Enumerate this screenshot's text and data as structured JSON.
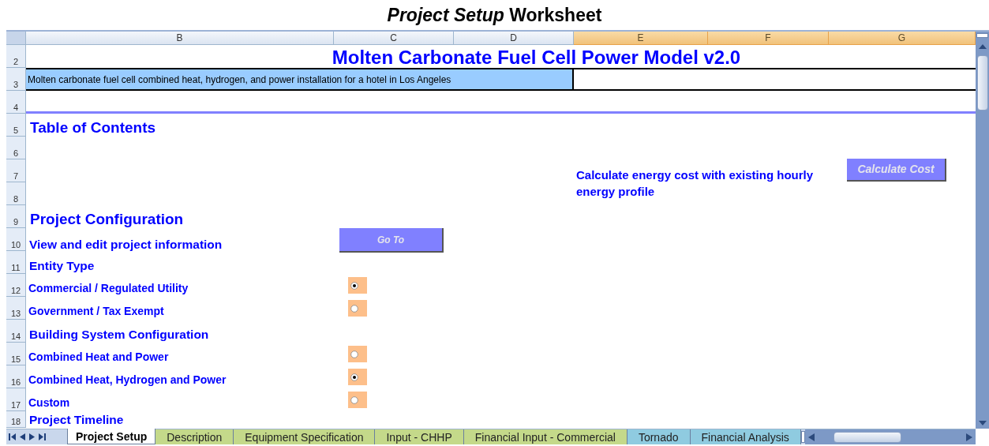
{
  "title": "*Project Setup* Worksheet",
  "columns": [
    {
      "label": "B",
      "selected": false
    },
    {
      "label": "C",
      "selected": false
    },
    {
      "label": "D",
      "selected": false
    },
    {
      "label": "E",
      "selected": true
    },
    {
      "label": "F",
      "selected": true
    },
    {
      "label": "G",
      "selected": true
    }
  ],
  "rows": [
    {
      "number": "2",
      "items": [
        {
          "kind": "banner",
          "text": "Molten Carbonate Fuel Cell Power Model v2.0"
        }
      ]
    },
    {
      "number": "3",
      "items": [
        {
          "kind": "description",
          "text": "Molten carbonate fuel cell combined heat, hydrogen, and power installation for a hotel in Los Angeles"
        }
      ]
    },
    {
      "number": "4",
      "items": []
    },
    {
      "number": "5",
      "items": [
        {
          "kind": "section",
          "text": "Table of Contents"
        }
      ]
    },
    {
      "number": "6",
      "items": []
    },
    {
      "number": "7",
      "items": [
        {
          "kind": "note",
          "text": "Calculate energy cost with existing hourly energy profile"
        },
        {
          "kind": "button",
          "text": "Calculate Cost"
        }
      ]
    },
    {
      "number": "8",
      "items": []
    },
    {
      "number": "9",
      "items": [
        {
          "kind": "section",
          "text": "Project Configuration"
        }
      ]
    },
    {
      "number": "10",
      "items": [
        {
          "kind": "label",
          "text": "View and edit project information"
        },
        {
          "kind": "button",
          "text": "Go To"
        }
      ]
    },
    {
      "number": "11",
      "items": [
        {
          "kind": "label",
          "text": "Entity Type"
        }
      ]
    },
    {
      "number": "12",
      "items": [
        {
          "kind": "option",
          "text": "Commercial / Regulated Utility",
          "selected": true
        }
      ]
    },
    {
      "number": "13",
      "items": [
        {
          "kind": "option",
          "text": "Government / Tax Exempt",
          "selected": false
        }
      ]
    },
    {
      "number": "14",
      "items": [
        {
          "kind": "label",
          "text": "Building System Configuration"
        }
      ]
    },
    {
      "number": "15",
      "items": [
        {
          "kind": "option",
          "text": "Combined Heat and Power",
          "selected": false
        }
      ]
    },
    {
      "number": "16",
      "items": [
        {
          "kind": "option",
          "text": "Combined Heat, Hydrogen and Power",
          "selected": true
        }
      ]
    },
    {
      "number": "17",
      "items": [
        {
          "kind": "option",
          "text": "Custom",
          "selected": false
        }
      ]
    },
    {
      "number": "18",
      "items": [
        {
          "kind": "label",
          "text": "Project Timeline"
        }
      ]
    }
  ],
  "sheet_tabs": [
    {
      "label": "Project Setup",
      "selected": true,
      "color": "#ffffff"
    },
    {
      "label": "Description",
      "selected": false,
      "color": "#c4d98a"
    },
    {
      "label": "Equipment Specification",
      "selected": false,
      "color": "#c4d98a"
    },
    {
      "label": "Input - CHHP",
      "selected": false,
      "color": "#c4d98a"
    },
    {
      "label": "Financial Input - Commercial",
      "selected": false,
      "color": "#c4d98a"
    },
    {
      "label": "Tornado",
      "selected": false,
      "color": "#8fcbe0"
    },
    {
      "label": "Financial Analysis",
      "selected": false,
      "color": "#8fcbe0"
    }
  ]
}
